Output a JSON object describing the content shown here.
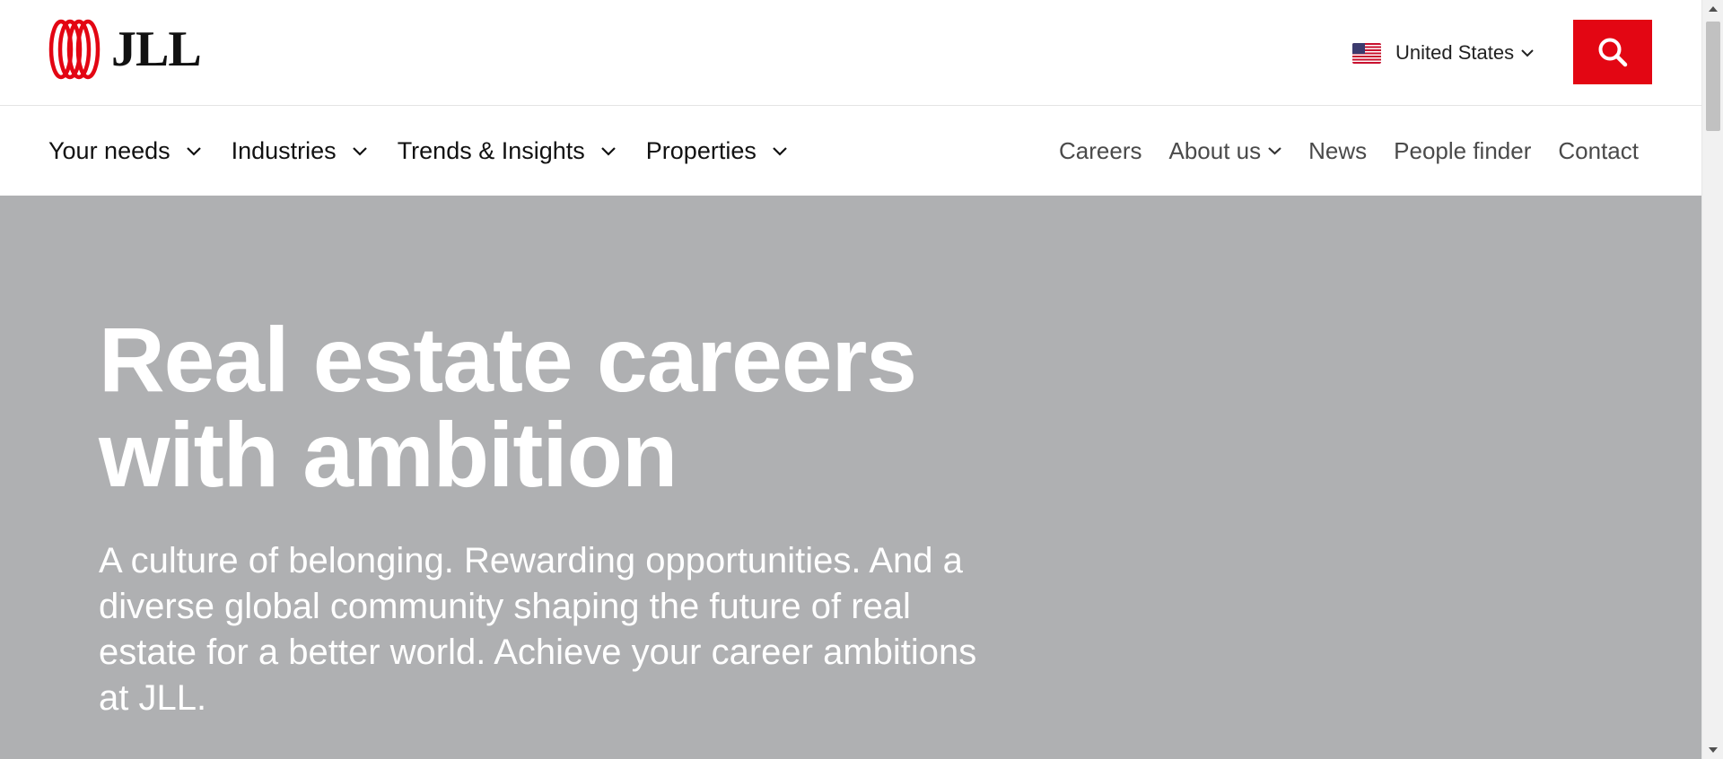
{
  "brand": {
    "logo_text": "JLL",
    "logo_icon": "jll-rings-logo",
    "accent_color": "#e30613"
  },
  "header": {
    "country": {
      "flag_icon": "us-flag-icon",
      "label": "United States"
    },
    "search_icon": "search-icon"
  },
  "nav": {
    "primary": [
      {
        "label": "Your needs"
      },
      {
        "label": "Industries"
      },
      {
        "label": "Trends & Insights"
      },
      {
        "label": "Properties"
      }
    ],
    "secondary": [
      {
        "label": "Careers"
      },
      {
        "label": "About us"
      },
      {
        "label": "News"
      },
      {
        "label": "People finder"
      },
      {
        "label": "Contact"
      }
    ]
  },
  "hero": {
    "title": "Real estate careers with ambition",
    "subtitle": "A culture of belonging. Rewarding opportunities. And a diverse global community shaping the future of real estate for a better world. Achieve your career ambitions at JLL.",
    "background_color": "#afb0b2"
  }
}
